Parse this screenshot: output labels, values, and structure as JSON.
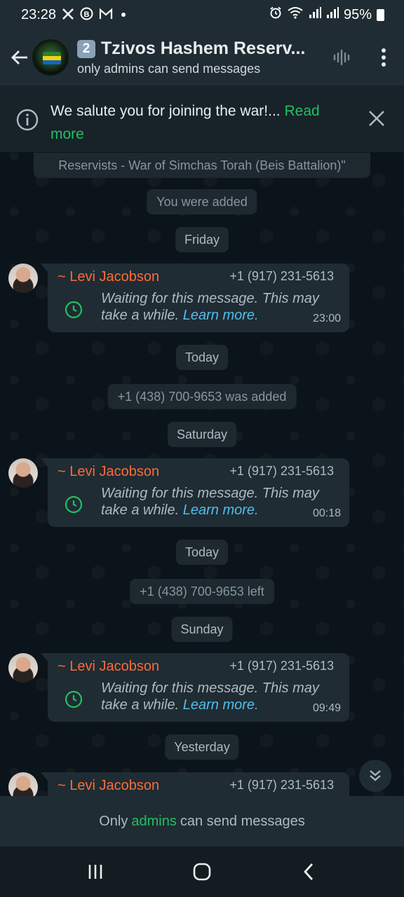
{
  "status_bar": {
    "time": "23:28",
    "notif_icons": [
      "x-icon",
      "b-icon",
      "gmail-icon"
    ],
    "battery": "95%"
  },
  "header": {
    "badge": "2",
    "title": "Tzivos Hashem Reserv...",
    "subtitle": "only admins can send messages"
  },
  "pinned": {
    "text": "We salute you for joining the war!...",
    "read_more": "Read more"
  },
  "chat": {
    "partial_system": "Reservists - War of Simchas Torah (Beis Battalion)\"",
    "system_added": "You were added",
    "date_1": "Friday",
    "date_2": "Today",
    "system_joined": "+1 (438) 700-9653 was added",
    "date_3": "Saturday",
    "date_4": "Today",
    "system_left": "+1 (438) 700-9653 left",
    "date_5": "Sunday",
    "date_6": "Yesterday",
    "messages": [
      {
        "sender": "~ Levi Jacobson",
        "phone": "+1 (917) 231-5613",
        "text": "Waiting for this message. This may take a while.",
        "link": "Learn more.",
        "time": "23:00"
      },
      {
        "sender": "~ Levi Jacobson",
        "phone": "+1 (917) 231-5613",
        "text": "Waiting for this message. This may take a while.",
        "link": "Learn more.",
        "time": "00:18"
      },
      {
        "sender": "~ Levi Jacobson",
        "phone": "+1 (917) 231-5613",
        "text": "Waiting for this message. This may take a while.",
        "link": "Learn more.",
        "time": "09:49"
      },
      {
        "sender": "~ Levi Jacobson",
        "phone": "+1 (917) 231-5613"
      }
    ]
  },
  "bottom": {
    "prefix": "Only",
    "link": "admins",
    "suffix": "can send messages"
  },
  "colors": {
    "accent_green": "#21c063",
    "sender_orange": "#fc6b39",
    "link_blue": "#53bdeb",
    "bubble_bg": "#1f2c33"
  }
}
